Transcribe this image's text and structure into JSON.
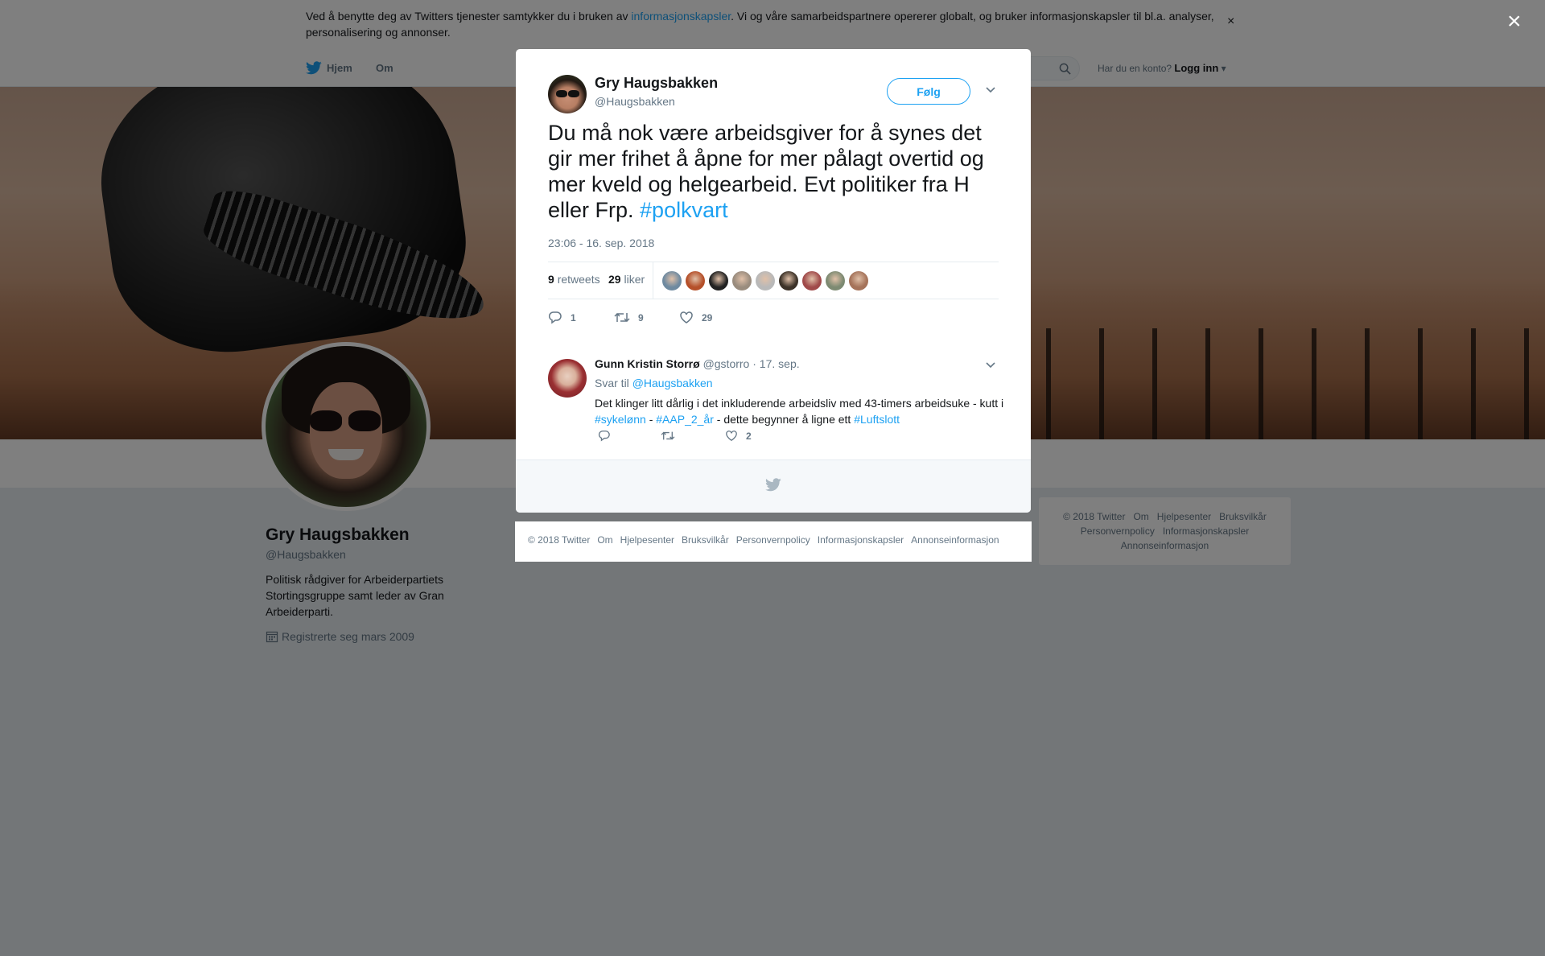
{
  "cookie_banner": {
    "text_before": "Ved å benytte deg av Twitters tjenester samtykker du i bruken av ",
    "link": "informasjonskapsler",
    "text_after": ". Vi og våre samarbeidspartnere opererer globalt, og bruker informasjonskapsler til bl.a. analyser, personalisering og annonser.",
    "close": "×"
  },
  "nav": {
    "home": "Hjem",
    "about": "Om",
    "login_prompt": "Har du en konto?",
    "login": "Logg inn"
  },
  "profile": {
    "name": "Gry Haugsbakken",
    "handle": "@Haugsbakken",
    "bio": "Politisk rådgiver for Arbeiderpartiets Stortingsgruppe samt leder av Gran Arbeiderparti.",
    "joined": "Registrerte seg mars 2009"
  },
  "overlay": {
    "close": "×"
  },
  "tweet": {
    "author_name": "Gry Haugsbakken",
    "author_handle": "@Haugsbakken",
    "follow": "Følg",
    "text": "Du må nok være arbeidsgiver for å synes det gir mer frihet å åpne for mer pålagt overtid og mer kveld og helgearbeid. Evt politiker fra H eller Frp. ",
    "hashtag": "#polkvart",
    "timestamp": "23:06 - 16. sep. 2018",
    "retweets_count": "9",
    "retweets_label": "retweets",
    "likes_count": "29",
    "likes_label": "liker",
    "action_reply_count": "1",
    "action_retweet_count": "9",
    "action_like_count": "29",
    "liker_colors": [
      "#6f8aa0",
      "#b5502a",
      "#222222",
      "#9a8c7e",
      "#b9b9b9",
      "#3c3228",
      "#a04a4a",
      "#7d8a72",
      "#a5735a"
    ]
  },
  "reply": {
    "author_name": "Gunn Kristin Storrø",
    "author_handle": "@gstorro",
    "date": "· 17. sep.",
    "reply_to_label": "Svar til",
    "reply_to_handle": "@Haugsbakken",
    "text_1": "Det klinger litt dårlig i det inkluderende arbeidsliv med 43-timers arbeidsuke - kutt i ",
    "tag_1": "#sykelønn",
    "text_2": " - ",
    "tag_2": "#AAP_2_år",
    "text_3": " - dette begynner å ligne ett ",
    "tag_3": "#Luftslott",
    "like_count": "2"
  },
  "footer_links": [
    "© 2018 Twitter",
    "Om",
    "Hjelpesenter",
    "Bruksvilkår",
    "Personvernpolicy",
    "Informasjonskapsler",
    "Annonseinformasjon"
  ],
  "side_footer": {
    "row1": [
      "© 2018 Twitter",
      "Om",
      "Hjelpesenter",
      "Bruksvilkår"
    ],
    "row2": [
      "Personvernpolicy",
      "Informasjonskapsler"
    ],
    "row3": [
      "Annonseinformasjon"
    ]
  },
  "colors": {
    "accent": "#1da1f2",
    "overlay": "rgba(0,0,0,0.5)",
    "text_secondary": "#657786"
  }
}
